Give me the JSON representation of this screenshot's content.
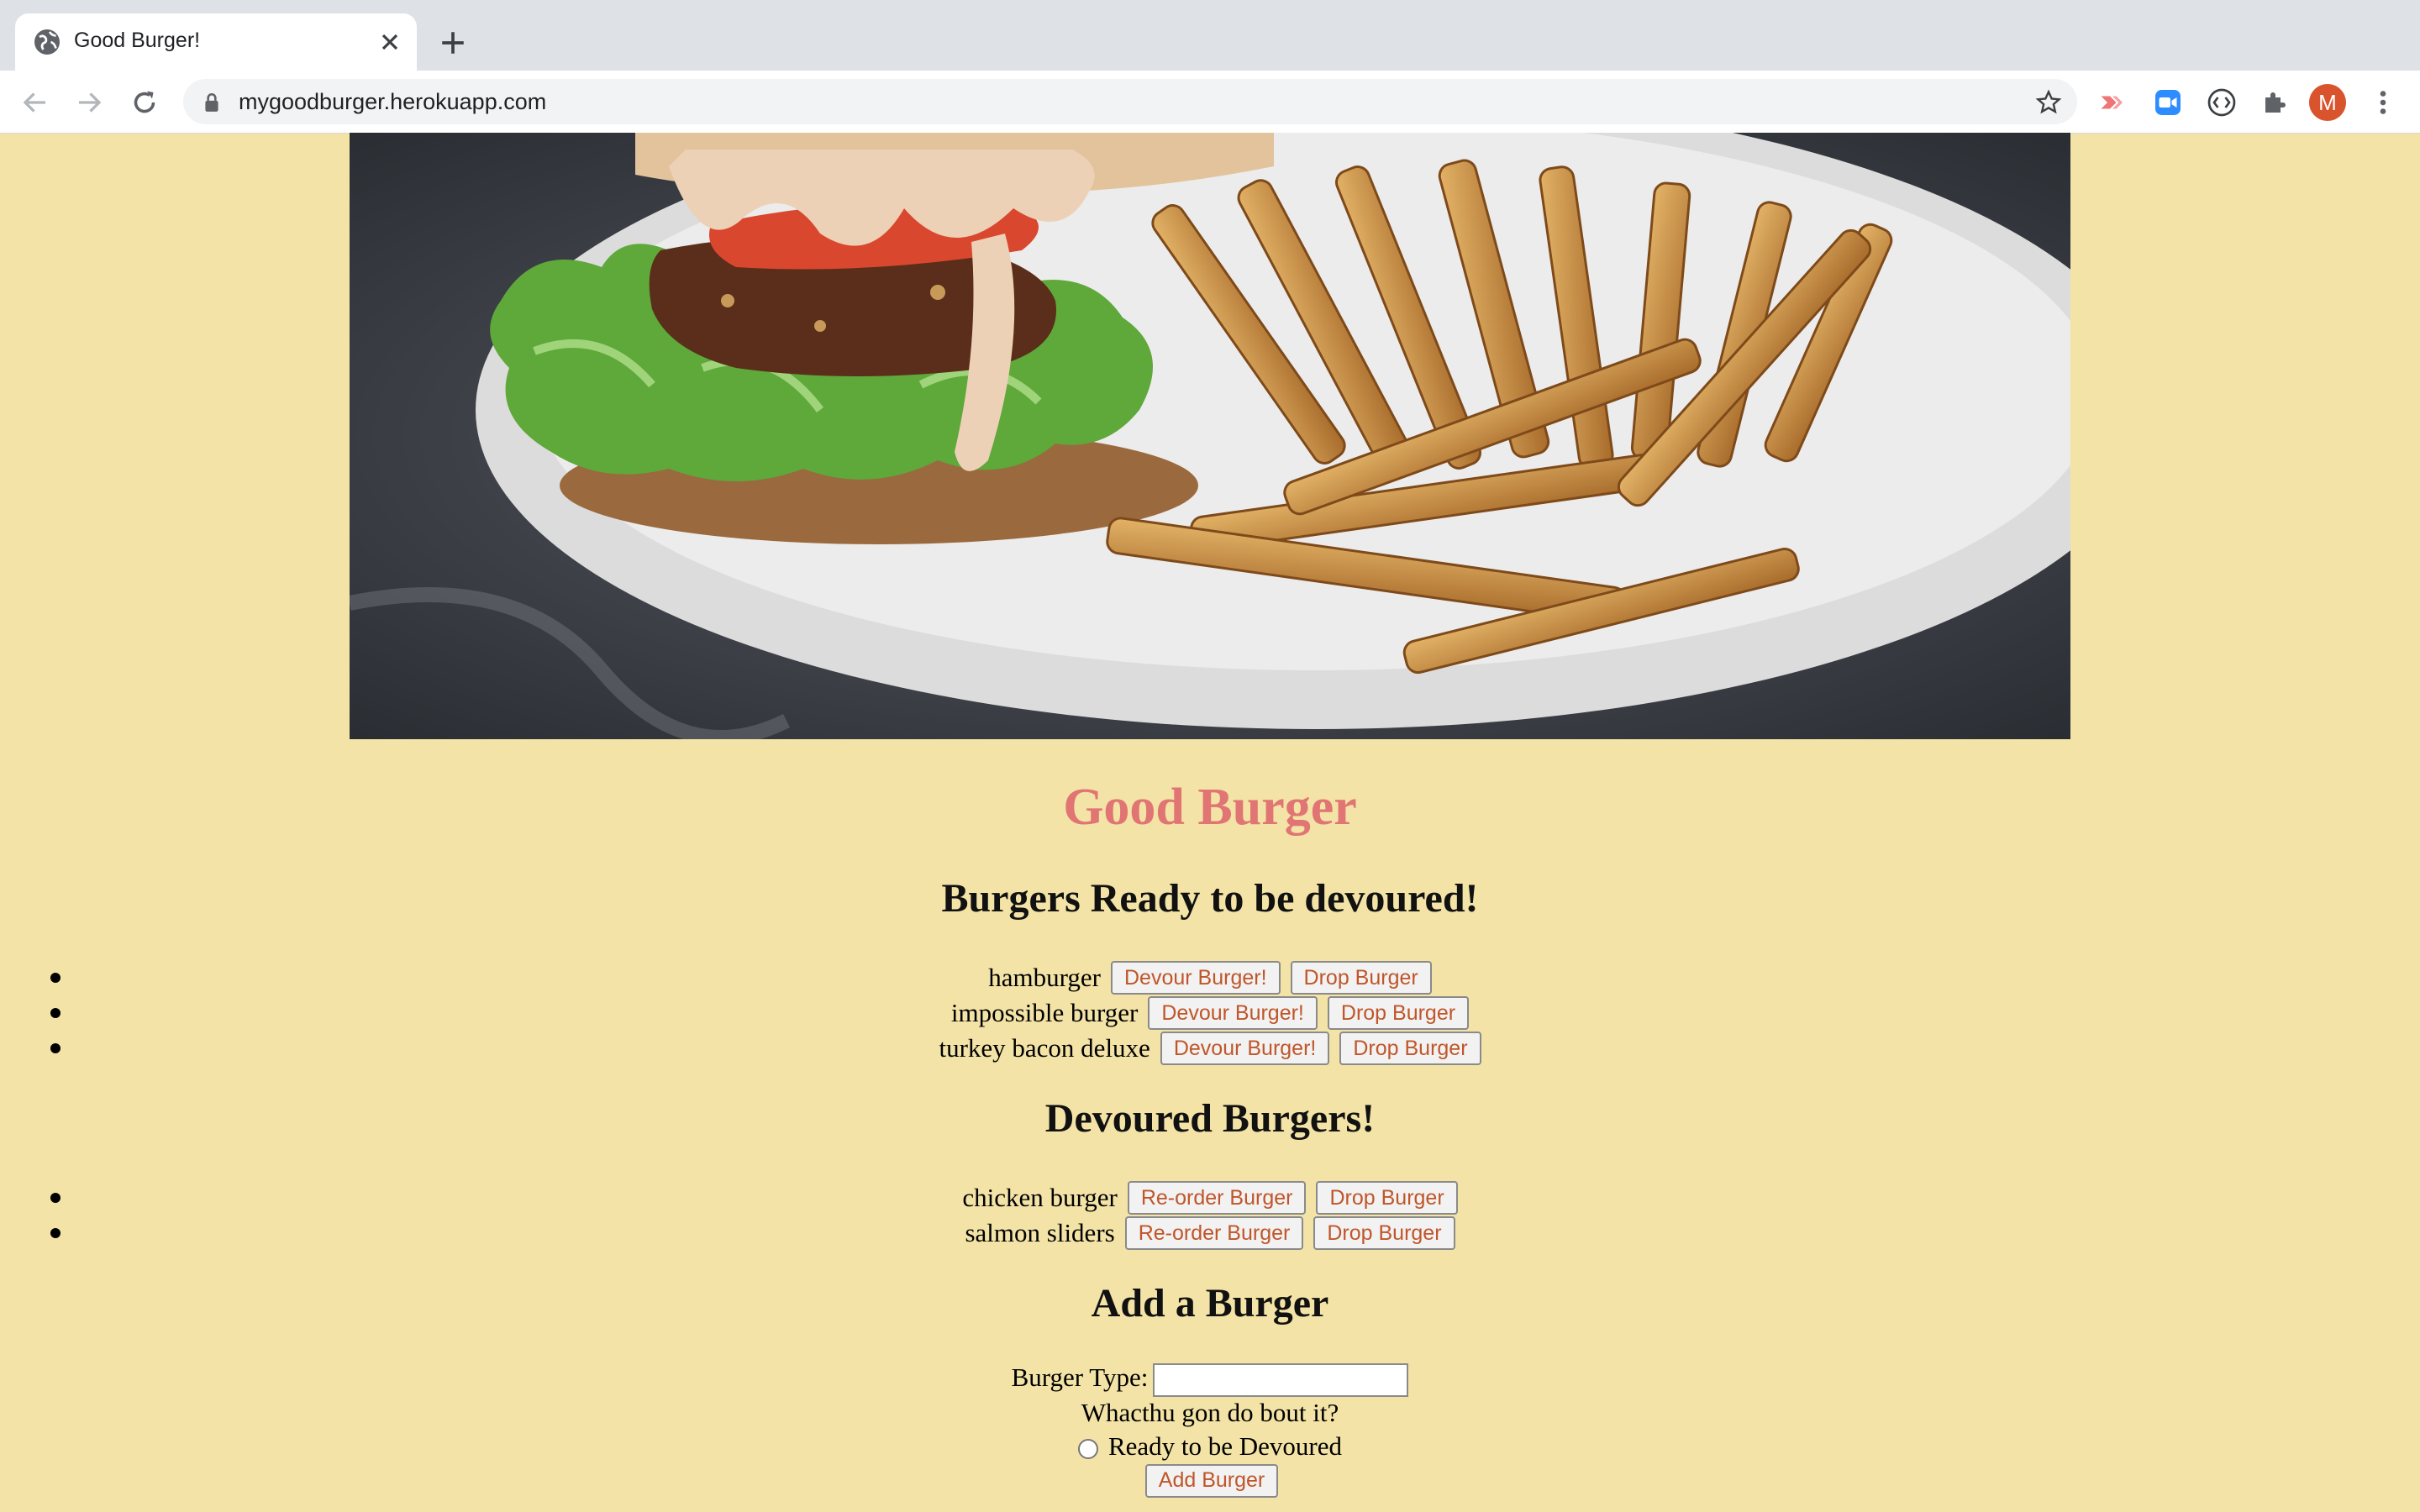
{
  "browser": {
    "tab_title": "Good Burger!",
    "url": "mygoodburger.herokuapp.com",
    "profile_initial": "M"
  },
  "page": {
    "title": "Good Burger",
    "ready_heading": "Burgers Ready to be devoured!",
    "ready_burgers": [
      {
        "name": "hamburger",
        "action": "Devour Burger!",
        "drop": "Drop Burger"
      },
      {
        "name": "impossible burger",
        "action": "Devour Burger!",
        "drop": "Drop Burger"
      },
      {
        "name": "turkey bacon deluxe",
        "action": "Devour Burger!",
        "drop": "Drop Burger"
      }
    ],
    "devoured_heading": "Devoured Burgers!",
    "devoured_burgers": [
      {
        "name": "chicken burger",
        "action": "Re-order Burger",
        "drop": "Drop Burger"
      },
      {
        "name": "salmon sliders",
        "action": "Re-order Burger",
        "drop": "Drop Burger"
      }
    ],
    "add_heading": "Add a Burger",
    "form": {
      "type_label": "Burger Type:",
      "type_value": "",
      "question": "Whacthu gon do bout it?",
      "radio_label": "Ready to be Devoured",
      "submit_label": "Add Burger"
    }
  },
  "colors": {
    "background": "#f3e3a6",
    "title": "#e07574",
    "button_text": "#c0562a"
  },
  "icons": [
    "globe-icon",
    "close-icon",
    "plus-icon",
    "back-arrow-icon",
    "forward-arrow-icon",
    "reload-icon",
    "lock-icon",
    "star-icon",
    "extension-icons",
    "puzzle-icon",
    "more-vert-icon"
  ]
}
